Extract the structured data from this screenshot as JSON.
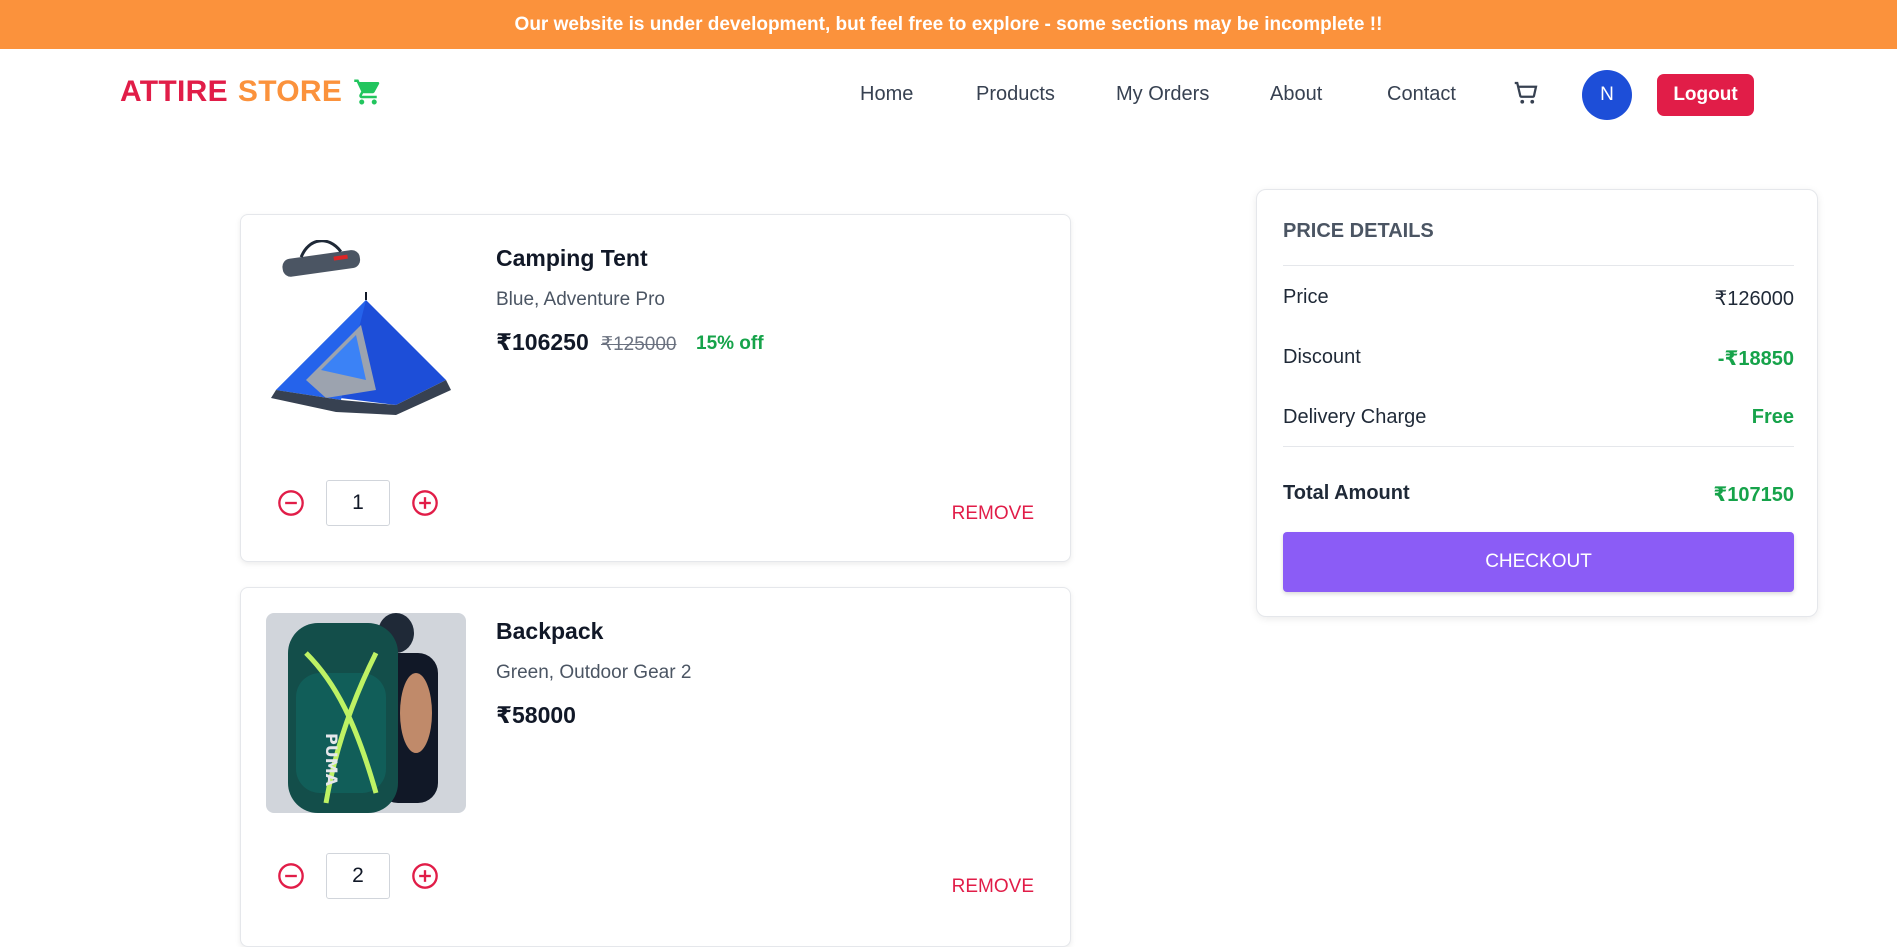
{
  "banner": {
    "text": "Our website is under development, but feel free to explore - some sections may be incomplete !!"
  },
  "header": {
    "logo_word1": "ATTIRE",
    "logo_word2": "STORE",
    "nav": [
      "Home",
      "Products",
      "My Orders",
      "About",
      "Contact"
    ],
    "avatar_initial": "N",
    "logout_label": "Logout"
  },
  "cart": {
    "items": [
      {
        "name": "Camping Tent",
        "variant": "Blue, Adventure Pro",
        "price": "₹106250",
        "mrp": "₹125000",
        "discount": "15% off",
        "quantity": "1",
        "remove_label": "REMOVE"
      },
      {
        "name": "Backpack",
        "variant": "Green, Outdoor Gear 2",
        "price": "₹58000",
        "quantity": "2",
        "remove_label": "REMOVE"
      }
    ]
  },
  "summary": {
    "title": "PRICE DETAILS",
    "price_label": "Price",
    "price_value": "₹126000",
    "discount_label": "Discount",
    "discount_value": "-₹18850",
    "delivery_label": "Delivery Charge",
    "delivery_value": "Free",
    "total_label": "Total Amount",
    "total_value": "₹107150",
    "checkout_label": "CHECKOUT"
  },
  "colors": {
    "banner": "#fb923c",
    "brand_red": "#e11d48",
    "brand_orange": "#fb923c",
    "green": "#16a34a",
    "checkout": "#8b5cf6",
    "avatar": "#1d4ed8"
  },
  "icons": {
    "logo": "shopping-cart-icon",
    "nav_cart": "cart-icon",
    "minus": "minus-circle-icon",
    "plus": "plus-circle-icon"
  }
}
